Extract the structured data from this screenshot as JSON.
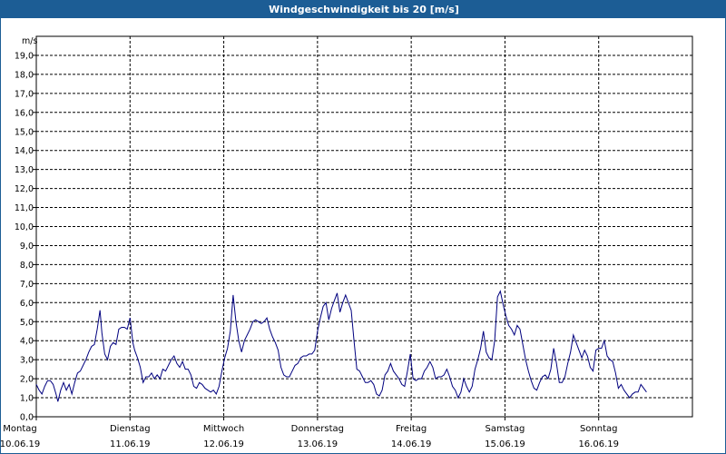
{
  "window": {
    "title": "Windgeschwindigkeit bis 20 [m/s]"
  },
  "colors": {
    "title_bar": "#1c5d95",
    "series_line": "#00007f",
    "grid": "#000000"
  },
  "chart_data": {
    "type": "line",
    "title": "Windgeschwindigkeit bis 20 [m/s]",
    "ylabel": "m/s",
    "ylim": [
      0,
      20
    ],
    "y_ticks": [
      "0,0",
      "1,0",
      "2,0",
      "3,0",
      "4,0",
      "5,0",
      "6,0",
      "7,0",
      "8,0",
      "9,0",
      "10,0",
      "11,0",
      "12,0",
      "13,0",
      "14,0",
      "15,0",
      "16,0",
      "17,0",
      "18,0",
      "19,0"
    ],
    "x_unit": "days since Monday 10.06.19 00:00",
    "xlim": [
      0,
      7
    ],
    "x_labels": [
      {
        "day": "Montag",
        "date": "10.06.19",
        "x": 0
      },
      {
        "day": "Dienstag",
        "date": "11.06.19",
        "x": 1
      },
      {
        "day": "Mittwoch",
        "date": "12.06.19",
        "x": 2
      },
      {
        "day": "Donnerstag",
        "date": "13.06.19",
        "x": 3
      },
      {
        "day": "Freitag",
        "date": "14.06.19",
        "x": 4
      },
      {
        "day": "Samstag",
        "date": "15.06.19",
        "x": 5
      },
      {
        "day": "Sonntag",
        "date": "16.06.19",
        "x": 6
      }
    ],
    "grid": true,
    "series": [
      {
        "name": "Windgeschwindigkeit",
        "points": [
          [
            0.0,
            1.7
          ],
          [
            0.03,
            1.4
          ],
          [
            0.06,
            1.2
          ],
          [
            0.09,
            1.6
          ],
          [
            0.12,
            1.9
          ],
          [
            0.15,
            1.9
          ],
          [
            0.18,
            1.7
          ],
          [
            0.21,
            1.2
          ],
          [
            0.23,
            0.8
          ],
          [
            0.26,
            1.4
          ],
          [
            0.29,
            1.8
          ],
          [
            0.32,
            1.4
          ],
          [
            0.35,
            1.7
          ],
          [
            0.38,
            1.2
          ],
          [
            0.41,
            1.8
          ],
          [
            0.44,
            2.3
          ],
          [
            0.47,
            2.4
          ],
          [
            0.5,
            2.7
          ],
          [
            0.53,
            3.0
          ],
          [
            0.56,
            3.4
          ],
          [
            0.59,
            3.7
          ],
          [
            0.62,
            3.8
          ],
          [
            0.65,
            4.6
          ],
          [
            0.68,
            5.6
          ],
          [
            0.7,
            4.4
          ],
          [
            0.73,
            3.3
          ],
          [
            0.76,
            3.0
          ],
          [
            0.79,
            3.7
          ],
          [
            0.82,
            3.9
          ],
          [
            0.85,
            3.8
          ],
          [
            0.88,
            4.6
          ],
          [
            0.91,
            4.7
          ],
          [
            0.94,
            4.7
          ],
          [
            0.97,
            4.6
          ],
          [
            1.0,
            5.2
          ],
          [
            1.03,
            3.9
          ],
          [
            1.05,
            3.5
          ],
          [
            1.08,
            3.1
          ],
          [
            1.11,
            2.6
          ],
          [
            1.14,
            1.8
          ],
          [
            1.17,
            2.1
          ],
          [
            1.2,
            2.1
          ],
          [
            1.23,
            2.3
          ],
          [
            1.26,
            2.0
          ],
          [
            1.29,
            2.2
          ],
          [
            1.32,
            2.0
          ],
          [
            1.35,
            2.5
          ],
          [
            1.38,
            2.4
          ],
          [
            1.41,
            2.7
          ],
          [
            1.44,
            3.0
          ],
          [
            1.47,
            3.2
          ],
          [
            1.5,
            2.8
          ],
          [
            1.53,
            2.6
          ],
          [
            1.56,
            2.9
          ],
          [
            1.59,
            2.5
          ],
          [
            1.62,
            2.5
          ],
          [
            1.65,
            2.2
          ],
          [
            1.68,
            1.6
          ],
          [
            1.71,
            1.5
          ],
          [
            1.74,
            1.8
          ],
          [
            1.77,
            1.7
          ],
          [
            1.8,
            1.5
          ],
          [
            1.83,
            1.4
          ],
          [
            1.86,
            1.3
          ],
          [
            1.89,
            1.4
          ],
          [
            1.92,
            1.2
          ],
          [
            1.95,
            1.6
          ],
          [
            1.98,
            2.4
          ],
          [
            2.01,
            3.1
          ],
          [
            2.04,
            3.6
          ],
          [
            2.07,
            4.5
          ],
          [
            2.1,
            6.4
          ],
          [
            2.13,
            5.0
          ],
          [
            2.16,
            4.0
          ],
          [
            2.19,
            3.4
          ],
          [
            2.22,
            4.0
          ],
          [
            2.25,
            4.3
          ],
          [
            2.28,
            4.6
          ],
          [
            2.31,
            5.0
          ],
          [
            2.34,
            5.1
          ],
          [
            2.37,
            5.0
          ],
          [
            2.4,
            4.9
          ],
          [
            2.43,
            5.0
          ],
          [
            2.46,
            5.2
          ],
          [
            2.49,
            4.6
          ],
          [
            2.52,
            4.2
          ],
          [
            2.55,
            3.9
          ],
          [
            2.58,
            3.5
          ],
          [
            2.61,
            2.6
          ],
          [
            2.64,
            2.2
          ],
          [
            2.67,
            2.1
          ],
          [
            2.7,
            2.1
          ],
          [
            2.73,
            2.4
          ],
          [
            2.76,
            2.7
          ],
          [
            2.79,
            2.8
          ],
          [
            2.82,
            3.1
          ],
          [
            2.85,
            3.2
          ],
          [
            2.88,
            3.2
          ],
          [
            2.91,
            3.3
          ],
          [
            2.94,
            3.3
          ],
          [
            2.97,
            3.5
          ],
          [
            3.0,
            4.5
          ],
          [
            3.03,
            5.2
          ],
          [
            3.06,
            5.8
          ],
          [
            3.09,
            6.0
          ],
          [
            3.12,
            5.1
          ],
          [
            3.15,
            5.7
          ],
          [
            3.18,
            6.1
          ],
          [
            3.21,
            6.5
          ],
          [
            3.24,
            5.5
          ],
          [
            3.27,
            6.0
          ],
          [
            3.3,
            6.4
          ],
          [
            3.33,
            6.0
          ],
          [
            3.36,
            5.6
          ],
          [
            3.39,
            4.0
          ],
          [
            3.42,
            2.5
          ],
          [
            3.45,
            2.4
          ],
          [
            3.48,
            2.1
          ],
          [
            3.51,
            1.8
          ],
          [
            3.54,
            1.8
          ],
          [
            3.57,
            1.9
          ],
          [
            3.6,
            1.7
          ],
          [
            3.63,
            1.2
          ],
          [
            3.66,
            1.1
          ],
          [
            3.69,
            1.4
          ],
          [
            3.72,
            2.2
          ],
          [
            3.75,
            2.4
          ],
          [
            3.78,
            2.8
          ],
          [
            3.81,
            2.4
          ],
          [
            3.84,
            2.2
          ],
          [
            3.87,
            2.0
          ],
          [
            3.9,
            1.7
          ],
          [
            3.93,
            1.6
          ],
          [
            3.96,
            2.4
          ],
          [
            3.99,
            3.3
          ],
          [
            4.02,
            2.0
          ],
          [
            4.05,
            1.9
          ],
          [
            4.08,
            2.0
          ],
          [
            4.11,
            2.0
          ],
          [
            4.14,
            2.4
          ],
          [
            4.17,
            2.6
          ],
          [
            4.2,
            2.9
          ],
          [
            4.23,
            2.6
          ],
          [
            4.26,
            2.0
          ],
          [
            4.29,
            2.1
          ],
          [
            4.32,
            2.1
          ],
          [
            4.35,
            2.2
          ],
          [
            4.38,
            2.5
          ],
          [
            4.41,
            2.1
          ],
          [
            4.44,
            1.6
          ],
          [
            4.47,
            1.4
          ],
          [
            4.5,
            1.0
          ],
          [
            4.53,
            1.3
          ],
          [
            4.56,
            2.0
          ],
          [
            4.59,
            1.6
          ],
          [
            4.62,
            1.3
          ],
          [
            4.65,
            1.6
          ],
          [
            4.68,
            2.5
          ],
          [
            4.71,
            3.0
          ],
          [
            4.74,
            3.6
          ],
          [
            4.77,
            4.5
          ],
          [
            4.8,
            3.4
          ],
          [
            4.83,
            3.1
          ],
          [
            4.86,
            3.0
          ],
          [
            4.89,
            4.0
          ],
          [
            4.92,
            6.3
          ],
          [
            4.95,
            6.6
          ],
          [
            4.98,
            5.9
          ],
          [
            5.01,
            5.3
          ],
          [
            5.04,
            4.8
          ],
          [
            5.07,
            4.6
          ],
          [
            5.1,
            4.3
          ],
          [
            5.13,
            4.8
          ],
          [
            5.16,
            4.6
          ],
          [
            5.19,
            3.8
          ],
          [
            5.22,
            3.0
          ],
          [
            5.25,
            2.4
          ],
          [
            5.28,
            1.9
          ],
          [
            5.31,
            1.5
          ],
          [
            5.34,
            1.4
          ],
          [
            5.37,
            1.8
          ],
          [
            5.4,
            2.1
          ],
          [
            5.43,
            2.2
          ],
          [
            5.46,
            2.0
          ],
          [
            5.49,
            2.5
          ],
          [
            5.52,
            3.6
          ],
          [
            5.55,
            2.8
          ],
          [
            5.58,
            1.8
          ],
          [
            5.61,
            1.8
          ],
          [
            5.64,
            2.1
          ],
          [
            5.67,
            2.8
          ],
          [
            5.7,
            3.4
          ],
          [
            5.73,
            4.3
          ],
          [
            5.76,
            3.9
          ],
          [
            5.79,
            3.5
          ],
          [
            5.82,
            3.1
          ],
          [
            5.85,
            3.5
          ],
          [
            5.88,
            3.2
          ],
          [
            5.91,
            2.6
          ],
          [
            5.94,
            2.4
          ],
          [
            5.97,
            3.5
          ],
          [
            6.0,
            3.6
          ],
          [
            6.03,
            3.6
          ],
          [
            6.06,
            4.0
          ],
          [
            6.09,
            3.2
          ],
          [
            6.12,
            3.0
          ],
          [
            6.15,
            2.9
          ],
          [
            6.18,
            2.3
          ],
          [
            6.21,
            1.5
          ],
          [
            6.24,
            1.7
          ],
          [
            6.27,
            1.4
          ],
          [
            6.3,
            1.2
          ],
          [
            6.33,
            1.0
          ],
          [
            6.36,
            1.2
          ],
          [
            6.39,
            1.3
          ],
          [
            6.42,
            1.3
          ],
          [
            6.45,
            1.7
          ],
          [
            6.48,
            1.5
          ],
          [
            6.51,
            1.3
          ]
        ]
      }
    ]
  }
}
